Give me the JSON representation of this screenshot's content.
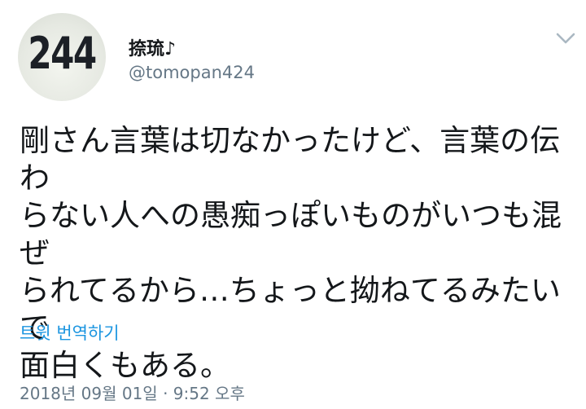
{
  "avatar": {
    "number": "244"
  },
  "user": {
    "display_name": "捺琉♪",
    "handle": "@tomopan424"
  },
  "tweet": {
    "text_lines": [
      "剛さん言葉は切なかったけど、言葉の伝わ",
      "らない人への愚痴っぽいものがいつも混ぜ",
      "られてるから…ちょっと拗ねてるみたいで",
      "面白くもある。"
    ],
    "translate_label": "트윗 번역하기",
    "timestamp": "2018년 09월 01일 · 9:52 오후"
  },
  "icons": {
    "menu": "chevron-down-icon"
  },
  "colors": {
    "text": "#14171a",
    "secondary": "#657786",
    "link": "#1b95e0",
    "chevron": "#aab8c2"
  }
}
